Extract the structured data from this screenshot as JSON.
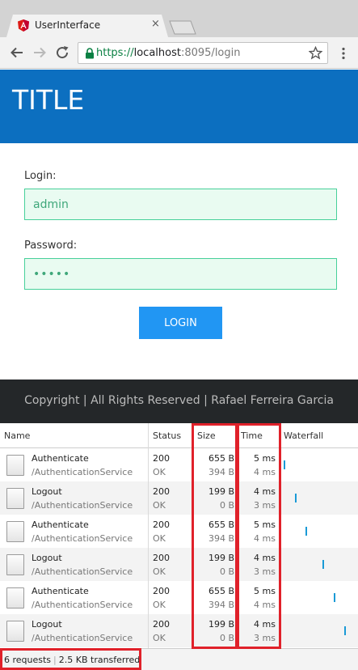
{
  "browser": {
    "tab_title": "UserInterface",
    "tab_close": "×",
    "url_scheme": "https://",
    "url_host": "localhost",
    "url_rest": ":8095/login"
  },
  "page": {
    "title": "TITLE",
    "login_label": "Login:",
    "login_value": "admin",
    "password_label": "Password:",
    "password_value": "•••••",
    "login_button": "LOGIN",
    "footer": "Copyright | All Rights Reserved | Rafael Ferreira Garcia"
  },
  "network": {
    "columns": {
      "name": "Name",
      "status": "Status",
      "size": "Size",
      "time": "Time",
      "waterfall": "Waterfall"
    },
    "requests": [
      {
        "name": "Authenticate",
        "path": "/AuthenticationService",
        "status": "200",
        "status_text": "OK",
        "size": "655 B",
        "content": "394 B",
        "time": "5 ms",
        "latency": "4 ms",
        "waterfall": 0.0
      },
      {
        "name": "Logout",
        "path": "/AuthenticationService",
        "status": "200",
        "status_text": "OK",
        "size": "199 B",
        "content": "0 B",
        "time": "4 ms",
        "latency": "3 ms",
        "waterfall": 0.19
      },
      {
        "name": "Authenticate",
        "path": "/AuthenticationService",
        "status": "200",
        "status_text": "OK",
        "size": "655 B",
        "content": "394 B",
        "time": "5 ms",
        "latency": "4 ms",
        "waterfall": 0.36
      },
      {
        "name": "Logout",
        "path": "/AuthenticationService",
        "status": "200",
        "status_text": "OK",
        "size": "199 B",
        "content": "0 B",
        "time": "4 ms",
        "latency": "3 ms",
        "waterfall": 0.64
      },
      {
        "name": "Authenticate",
        "path": "/AuthenticationService",
        "status": "200",
        "status_text": "OK",
        "size": "655 B",
        "content": "394 B",
        "time": "5 ms",
        "latency": "4 ms",
        "waterfall": 0.82
      },
      {
        "name": "Logout",
        "path": "/AuthenticationService",
        "status": "200",
        "status_text": "OK",
        "size": "199 B",
        "content": "0 B",
        "time": "4 ms",
        "latency": "3 ms",
        "waterfall": 1.0
      }
    ],
    "summary_requests": "6 requests",
    "summary_separator": "|",
    "summary_transferred": "2.5 KB transferred"
  },
  "colors": {
    "header_blue": "#0c6fc0",
    "input_border": "#47d09a",
    "button_blue": "#2196f3",
    "footer_bg": "#242729",
    "highlight_red": "#e0212a",
    "waterfall_bar": "#1a9ad6"
  },
  "icons": {
    "favicon": "angular-icon",
    "back": "back-arrow-icon",
    "forward": "forward-arrow-icon",
    "reload": "reload-icon",
    "lock": "lock-icon",
    "bookmark": "star-icon",
    "menu": "kebab-menu-icon",
    "request": "document-icon"
  }
}
